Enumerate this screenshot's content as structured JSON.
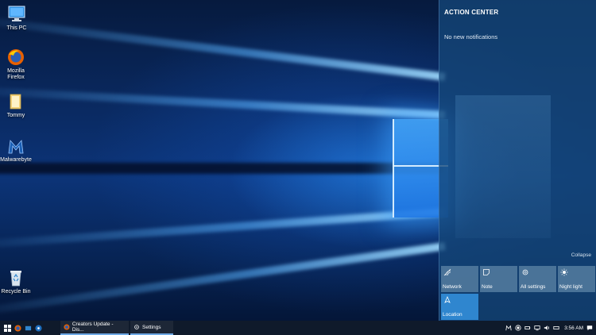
{
  "desktop": {
    "icons": [
      {
        "label": "This PC",
        "icon": "computer-icon"
      },
      {
        "label": "Mozilla Firefox",
        "line1": "Mozilla",
        "line2": "Firefox",
        "icon": "firefox-icon"
      },
      {
        "label": "Tommy",
        "icon": "folder-icon"
      },
      {
        "label": "Malwarebyte",
        "icon": "malwarebytes-icon"
      },
      {
        "label": "Recycle Bin",
        "icon": "recycle-bin-icon"
      }
    ]
  },
  "action_center": {
    "title": "ACTION CENTER",
    "empty_message": "No new notifications",
    "collapse_label": "Collapse",
    "tiles": [
      {
        "label": "Network",
        "icon": "network-icon",
        "active": false
      },
      {
        "label": "Note",
        "icon": "note-icon",
        "active": false
      },
      {
        "label": "All settings",
        "icon": "gear-icon",
        "active": false
      },
      {
        "label": "Night light",
        "icon": "brightness-icon",
        "active": false
      },
      {
        "label": "Location",
        "icon": "location-icon",
        "active": true
      }
    ]
  },
  "taskbar": {
    "apps": [
      {
        "label": "Creators Update - Dis...",
        "icon": "firefox-icon"
      },
      {
        "label": "Settings",
        "icon": "gear-icon"
      }
    ],
    "clock": "3:56 AM"
  },
  "colors": {
    "accent": "#2f86cf",
    "taskbar": "#0f1a2b",
    "action_center_bg": "#14467a"
  }
}
